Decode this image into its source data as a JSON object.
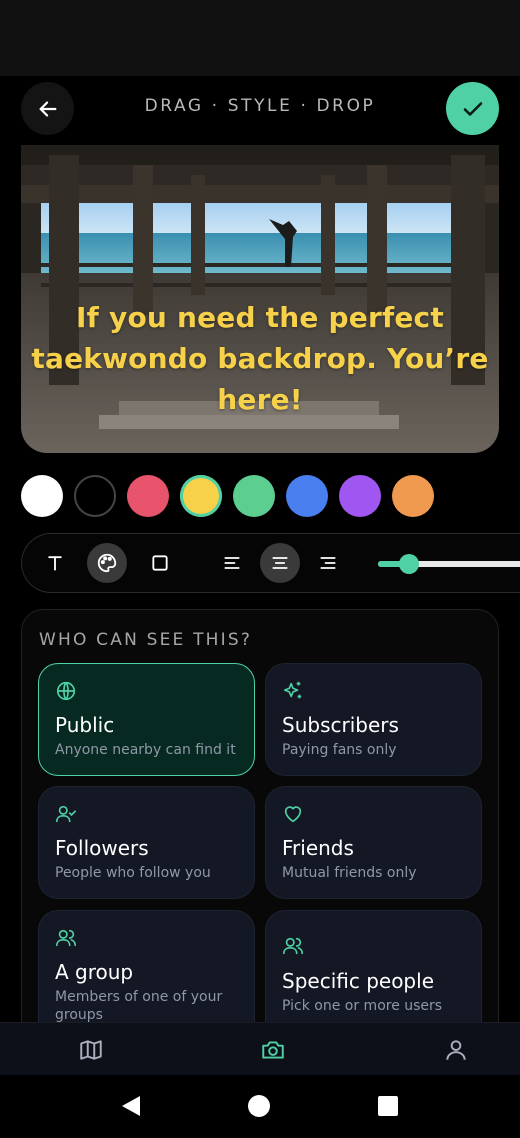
{
  "header": {
    "title": "DRAG · STYLE · DROP",
    "back_icon": "arrow-left-icon",
    "confirm_icon": "check-icon",
    "accent": "#4fd1a5"
  },
  "photo": {
    "caption": "If you need the perfect taekwondo backdrop. You’re here!",
    "caption_color": "#f7d14a"
  },
  "colors": {
    "swatches": [
      "#ffffff",
      "#000000",
      "#e8546c",
      "#f7d14a",
      "#5cce90",
      "#4a7ff0",
      "#a056f0",
      "#ef9a4e"
    ],
    "selected": "#f7d14a"
  },
  "toolbar": {
    "tools": [
      "text-icon",
      "palette-icon",
      "square-icon",
      "align-left-icon",
      "align-center-icon",
      "align-right-icon"
    ],
    "active_tool": "palette-icon",
    "active_align": "align-center-icon",
    "size_level": 0.2
  },
  "visibility": {
    "title": "WHO CAN SEE THIS?",
    "options": [
      {
        "icon": "globe-icon",
        "title": "Public",
        "subtitle": "Anyone nearby can find it",
        "selected": true
      },
      {
        "icon": "sparkles-icon",
        "title": "Subscribers",
        "subtitle": "Paying fans only",
        "selected": false
      },
      {
        "icon": "user-check-icon",
        "title": "Followers",
        "subtitle": "People who follow you",
        "selected": false
      },
      {
        "icon": "heart-icon",
        "title": "Friends",
        "subtitle": "Mutual friends only",
        "selected": false
      },
      {
        "icon": "users-icon",
        "title": "A group",
        "subtitle": "Members of one of your groups",
        "selected": false
      },
      {
        "icon": "users-icon",
        "title": "Specific people",
        "subtitle": "Pick one or more users",
        "selected": false
      }
    ]
  },
  "bottom_nav": {
    "items": [
      "map-icon",
      "camera-icon",
      "user-icon"
    ],
    "active": "camera-icon"
  },
  "system_nav": [
    "back-triangle-icon",
    "home-circle-icon",
    "recents-square-icon"
  ]
}
